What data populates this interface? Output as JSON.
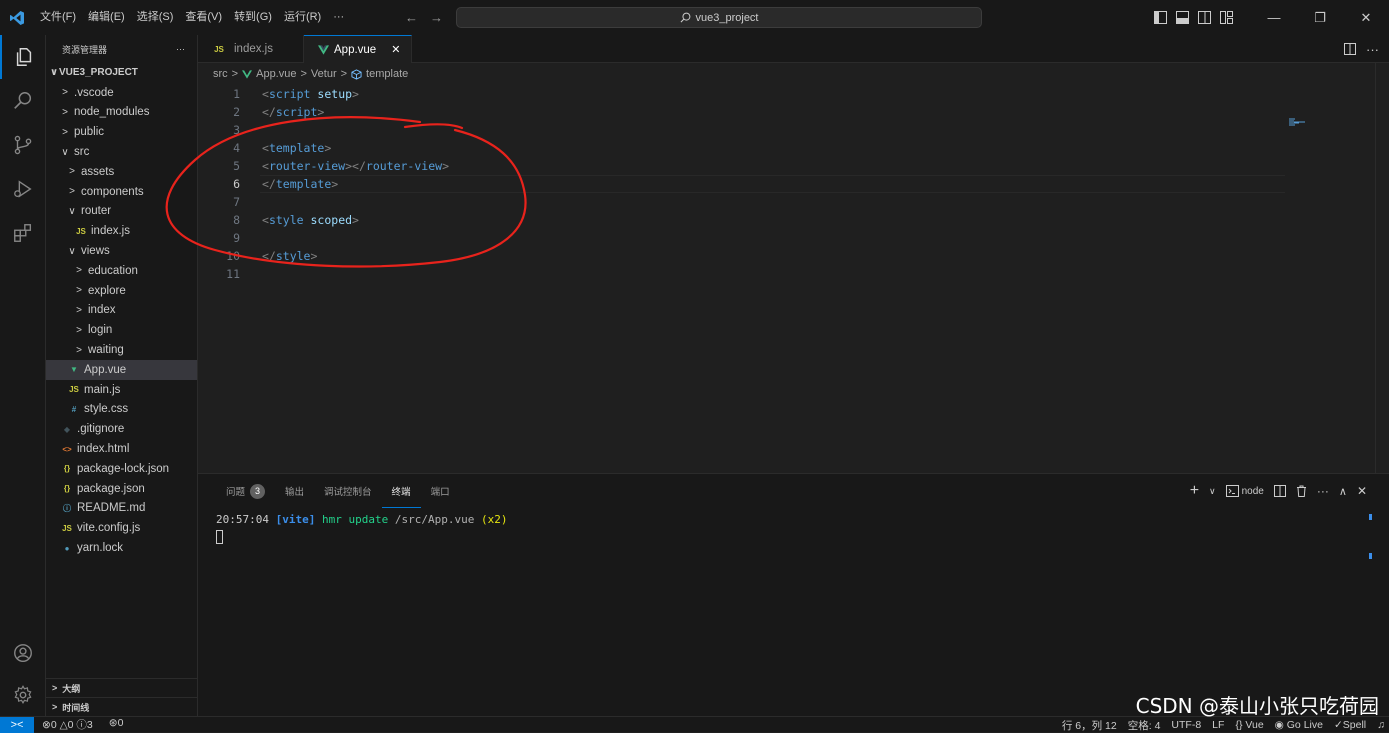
{
  "titlebar": {
    "menu": [
      "文件(F)",
      "编辑(E)",
      "选择(S)",
      "查看(V)",
      "转到(G)",
      "运行(R)",
      "···"
    ],
    "search_text": "vue3_project"
  },
  "sidebar": {
    "title": "资源管理器",
    "more": "···",
    "project": "VUE3_PROJECT",
    "items": [
      {
        "label": ".vscode",
        "depth": 0,
        "kind": "folder",
        "open": false
      },
      {
        "label": "node_modules",
        "depth": 0,
        "kind": "folder",
        "open": false
      },
      {
        "label": "public",
        "depth": 0,
        "kind": "folder",
        "open": false
      },
      {
        "label": "src",
        "depth": 0,
        "kind": "folder",
        "open": true
      },
      {
        "label": "assets",
        "depth": 1,
        "kind": "folder",
        "open": false
      },
      {
        "label": "components",
        "depth": 1,
        "kind": "folder",
        "open": false
      },
      {
        "label": "router",
        "depth": 1,
        "kind": "folder",
        "open": true
      },
      {
        "label": "index.js",
        "depth": 2,
        "kind": "js"
      },
      {
        "label": "views",
        "depth": 1,
        "kind": "folder",
        "open": true
      },
      {
        "label": "education",
        "depth": 2,
        "kind": "folder",
        "open": false
      },
      {
        "label": "explore",
        "depth": 2,
        "kind": "folder",
        "open": false
      },
      {
        "label": "index",
        "depth": 2,
        "kind": "folder",
        "open": false
      },
      {
        "label": "login",
        "depth": 2,
        "kind": "folder",
        "open": false
      },
      {
        "label": "waiting",
        "depth": 2,
        "kind": "folder",
        "open": false
      },
      {
        "label": "App.vue",
        "depth": 1,
        "kind": "vue",
        "selected": true
      },
      {
        "label": "main.js",
        "depth": 1,
        "kind": "js"
      },
      {
        "label": "style.css",
        "depth": 1,
        "kind": "css"
      },
      {
        "label": ".gitignore",
        "depth": 0,
        "kind": "git"
      },
      {
        "label": "index.html",
        "depth": 0,
        "kind": "html"
      },
      {
        "label": "package-lock.json",
        "depth": 0,
        "kind": "json"
      },
      {
        "label": "package.json",
        "depth": 0,
        "kind": "json"
      },
      {
        "label": "README.md",
        "depth": 0,
        "kind": "info"
      },
      {
        "label": "vite.config.js",
        "depth": 0,
        "kind": "js"
      },
      {
        "label": "yarn.lock",
        "depth": 0,
        "kind": "yarn"
      }
    ],
    "outline": "大纲",
    "timeline": "时间线"
  },
  "tabs": [
    {
      "label": "index.js",
      "icon": "JS",
      "active": false
    },
    {
      "label": "App.vue",
      "icon": "vue",
      "active": true,
      "close": "✕"
    }
  ],
  "breadcrumb": [
    "src",
    "App.vue",
    "Vetur",
    "template"
  ],
  "code": {
    "current_line": 6,
    "lines": [
      {
        "n": "1",
        "parts": [
          [
            "tg",
            "<"
          ],
          [
            "tn",
            "script"
          ],
          [
            "tg",
            " "
          ],
          [
            "at",
            "setup"
          ],
          [
            "tg",
            ">"
          ]
        ]
      },
      {
        "n": "2",
        "parts": [
          [
            "tg",
            "</"
          ],
          [
            "tn",
            "script"
          ],
          [
            "tg",
            ">"
          ]
        ]
      },
      {
        "n": "3",
        "parts": []
      },
      {
        "n": "4",
        "parts": [
          [
            "tg",
            "<"
          ],
          [
            "tn",
            "template"
          ],
          [
            "tg",
            ">"
          ]
        ]
      },
      {
        "n": "5",
        "parts": [
          [
            "tg",
            "<"
          ],
          [
            "tn",
            "router-view"
          ],
          [
            "tg",
            "></"
          ],
          [
            "tn",
            "router-view"
          ],
          [
            "tg",
            ">"
          ]
        ]
      },
      {
        "n": "6",
        "parts": [
          [
            "tg",
            "</"
          ],
          [
            "tn",
            "template"
          ],
          [
            "tg",
            ">"
          ]
        ]
      },
      {
        "n": "7",
        "parts": []
      },
      {
        "n": "8",
        "parts": [
          [
            "tg",
            "<"
          ],
          [
            "tn",
            "style"
          ],
          [
            "tg",
            " "
          ],
          [
            "at",
            "scoped"
          ],
          [
            "tg",
            ">"
          ]
        ]
      },
      {
        "n": "9",
        "parts": []
      },
      {
        "n": "10",
        "parts": [
          [
            "tg",
            "</"
          ],
          [
            "tn",
            "style"
          ],
          [
            "tg",
            ">"
          ]
        ]
      },
      {
        "n": "11",
        "parts": []
      }
    ]
  },
  "panel": {
    "tabs": [
      {
        "label": "问题",
        "badge": "3",
        "active": false
      },
      {
        "label": "输出",
        "active": false
      },
      {
        "label": "调试控制台",
        "active": false
      },
      {
        "label": "终端",
        "active": true
      },
      {
        "label": "端口",
        "active": false
      }
    ],
    "terminal_name": "node",
    "terminal_line": {
      "time": "20:57:04",
      "tag": "[vite]",
      "msg": "hmr update",
      "path": "/src/App.vue",
      "count": "(x2)"
    }
  },
  "statusbar": {
    "errors": "0",
    "warnings": "0",
    "infos": "3",
    "ports": "0",
    "position": "行 6，列 12",
    "spaces": "空格: 4",
    "encoding": "UTF-8",
    "eol": "LF",
    "language": "Vue",
    "golive": "Go Live",
    "spell": "Spell"
  },
  "watermark": "CSDN @泰山小张只吃荷园",
  "colors": {
    "accent": "#0078d4",
    "annotation": "#e8231c",
    "vue": "#41b883",
    "js": "#cbcb41"
  }
}
